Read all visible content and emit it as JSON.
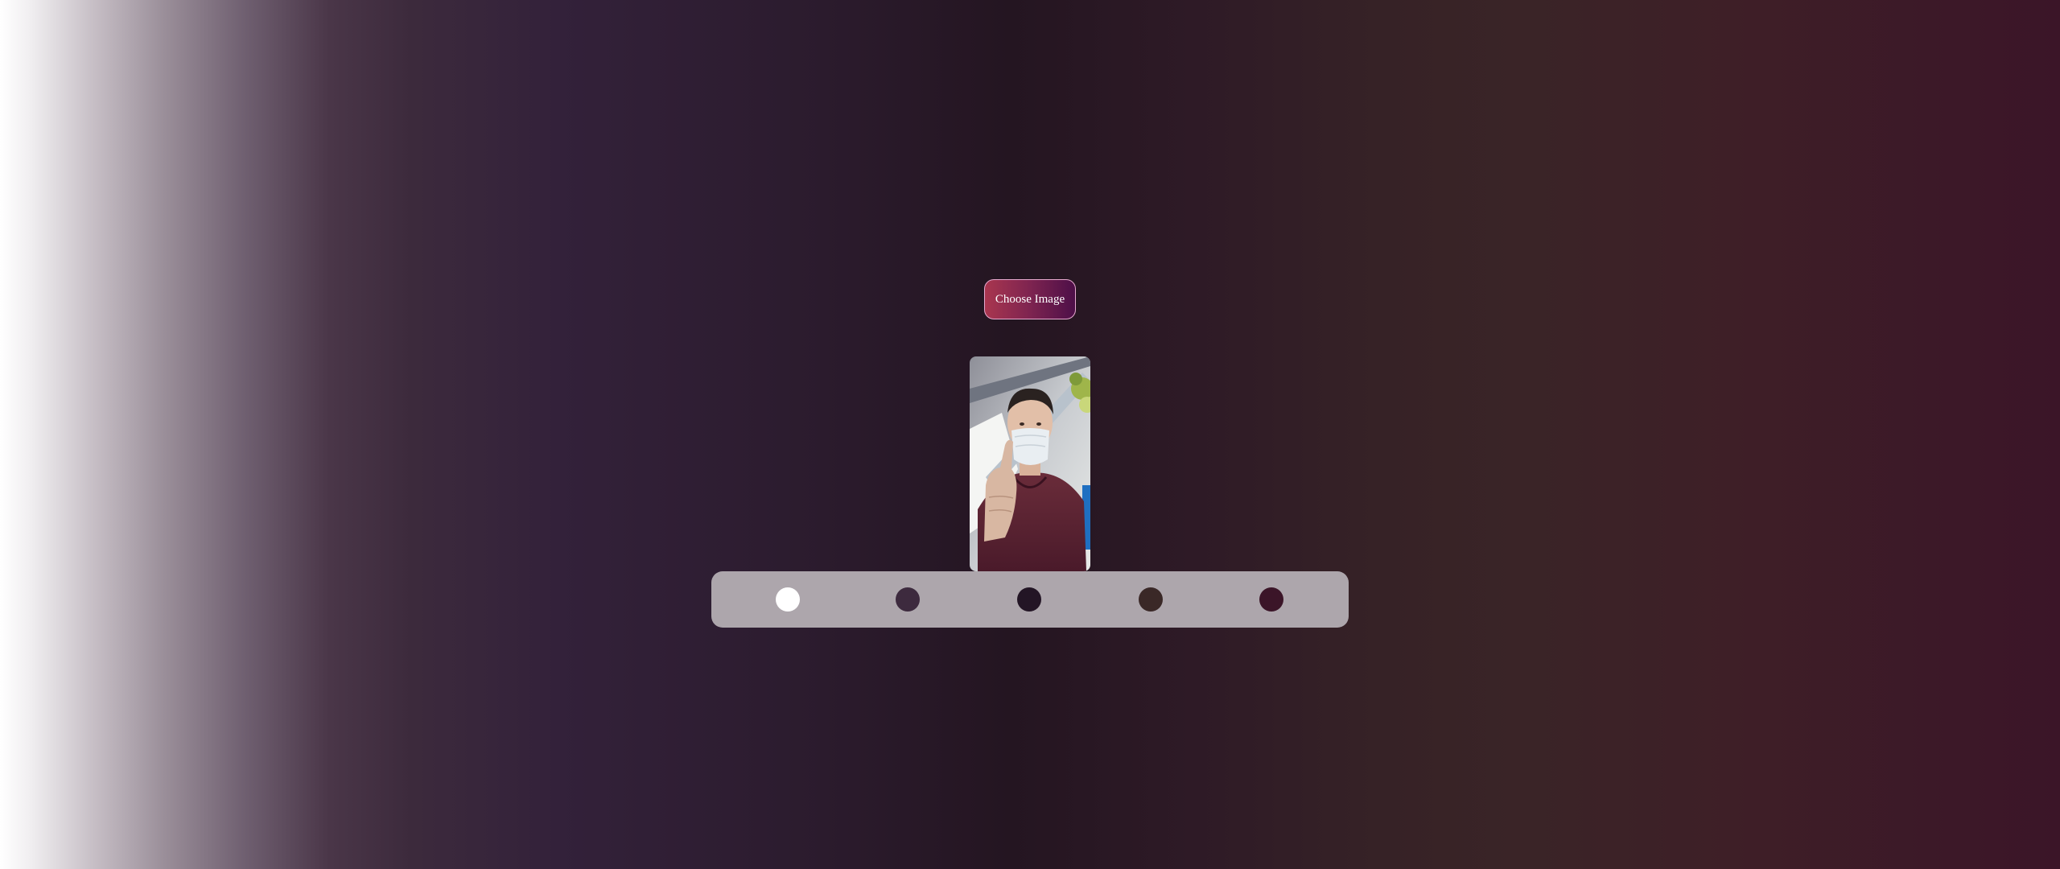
{
  "upload": {
    "button_label": "Choose Image"
  },
  "preview": {
    "icon": "photo-preview"
  },
  "palette": {
    "swatches": [
      {
        "color": "#ffffff"
      },
      {
        "color": "#3d2a3e"
      },
      {
        "color": "#231525"
      },
      {
        "color": "#3a2827"
      },
      {
        "color": "#3b1528"
      }
    ]
  },
  "colors": {
    "accent_gradient_start": "#a9364f",
    "accent_gradient_end": "#4d0f48",
    "button_border": "#e7a9cf",
    "palette_bar": "#ada6ac"
  }
}
